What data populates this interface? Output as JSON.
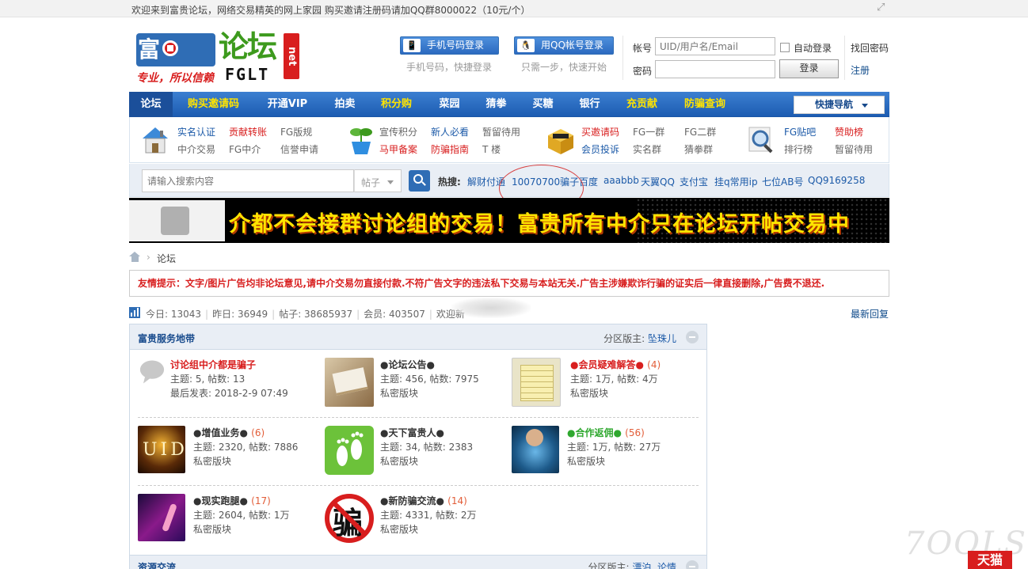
{
  "topbar": {
    "welcome": "欢迎来到富贵论坛，网络交易精英的网上家园  购买邀请注册码请加QQ群8000022（10元/个）"
  },
  "logo": {
    "line1": "富 贵",
    "big": "论坛",
    "net": "net",
    "slogan": "专业，所以信赖",
    "abbr": "FGLT"
  },
  "login": {
    "phone_button": "手机号码登录",
    "phone_hint": "手机号码，快捷登录",
    "qq_button": "用QQ帐号登录",
    "qq_hint": "只需一步，快速开始",
    "account_label": "帐号",
    "account_placeholder": "UID/用户名/Email",
    "password_label": "密码",
    "auto_login": "自动登录",
    "forgot": "找回密码",
    "login_button": "登录",
    "register": "注册"
  },
  "nav": {
    "items": [
      "论坛",
      "购买邀请码",
      "开通VIP",
      "拍卖",
      "积分购",
      "菜园",
      "猜拳",
      "买糖",
      "银行",
      "充贡献",
      "防骗查询"
    ],
    "quick_nav": "快捷导航"
  },
  "sublinks": {
    "group1": [
      "实名认证",
      "贡献转账",
      "FG版规",
      "中介交易",
      "FG中介",
      "信誉申请"
    ],
    "group2": [
      "宣传积分",
      "新人必看",
      "暂留待用",
      "马甲备案",
      "防骗指南",
      "T 楼"
    ],
    "group3": [
      "买邀请码",
      "FG一群",
      "FG二群",
      "会员投诉",
      "实名群",
      "猜拳群"
    ],
    "group4": [
      "FG贴吧",
      "赞助榜",
      "排行榜",
      "暂留待用"
    ]
  },
  "search": {
    "placeholder": "请输入搜索内容",
    "type": "帖子",
    "hot_label": "热搜:",
    "hot": [
      "解财付通",
      "10070700骗子",
      "百度",
      "aaabbb",
      "天翼QQ",
      "支付宝",
      "挂q常用ip",
      "七位AB号",
      "QQ9169258"
    ]
  },
  "banner": {
    "text": "介都不会接群讨论组的交易！富贵所有中介只在论坛开帖交易中"
  },
  "breadcrumb": {
    "current": "论坛"
  },
  "notice": "友情提示：文字/图片广告均非论坛意见,请中介交易勿直接付款.不符广告文字的违法私下交易与本站无关.广告主涉嫌欺诈行骗的证实后一律直接删除,广告费不退还.",
  "stats": {
    "today": "今日: 13043",
    "yesterday": "昨日: 36949",
    "posts": "帖子: 38685937",
    "members": "会员: 403507",
    "welcome": "欢迎新",
    "latest": "最新回复"
  },
  "section1": {
    "title": "富贵服务地带",
    "moderator_label": "分区版主:",
    "moderator": "坠珠儿",
    "forums": [
      {
        "title": "讨论组中介都是骗子",
        "count": "",
        "line1": "主题: 5, 帖数: 13",
        "line2": "最后发表: 2018-2-9 07:49"
      },
      {
        "title": "●论坛公告●",
        "count": "",
        "line1": "主题: 456, 帖数: 7975",
        "line2": "私密版块"
      },
      {
        "title": "●会员疑难解答●",
        "count": "(4)",
        "line1": "主题: 1万, 帖数: 4万",
        "line2": "私密版块"
      },
      {
        "title": "●增值业务●",
        "count": "(6)",
        "line1": "主题: 2320, 帖数: 7886",
        "line2": "私密版块"
      },
      {
        "title": "●天下富贵人●",
        "count": "",
        "line1": "主题: 34, 帖数: 2383",
        "line2": "私密版块"
      },
      {
        "title": "●合作返佣●",
        "count": "(56)",
        "line1": "主题: 1万, 帖数: 27万",
        "line2": "私密版块"
      },
      {
        "title": "●现实跑腿●",
        "count": "(17)",
        "line1": "主题: 2604, 帖数: 1万",
        "line2": "私密版块"
      },
      {
        "title": "●新防骗交流●",
        "count": "(14)",
        "line1": "主题: 4331, 帖数: 2万",
        "line2": "私密版块"
      }
    ],
    "uid_text": "UID",
    "fraud_char": "骗"
  },
  "section2": {
    "title": "资源交流",
    "moderator_label": "分区版主:",
    "moderator": "漂泊, 论情"
  },
  "watermark": {
    "tools": "7OOLS",
    "tmall": "天猫"
  },
  "colors": {
    "nav_blue": "#2f6db5",
    "accent_red": "#d81e1e",
    "banner_yellow": "#ffe400",
    "link_blue": "#1c5aa8"
  }
}
